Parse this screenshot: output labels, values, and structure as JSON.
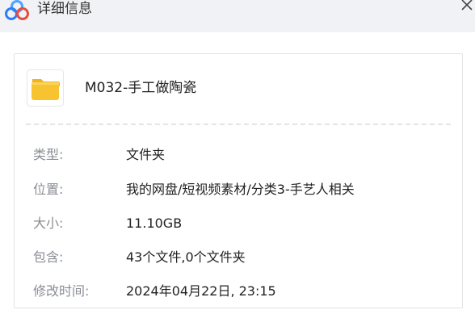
{
  "window": {
    "title": "详细信息",
    "logo_icon": "baidu-netdisk-logo",
    "close_icon": "close-icon"
  },
  "file": {
    "name": "M032-手工做陶瓷",
    "icon": "folder-icon",
    "icon_color": "#f7c331"
  },
  "details": [
    {
      "label": "类型:",
      "value": "文件夹"
    },
    {
      "label": "位置:",
      "value": "我的网盘/短视频素材/分类3-手艺人相关"
    },
    {
      "label": "大小:",
      "value": "11.10GB"
    },
    {
      "label": "包含:",
      "value": "43个文件,0个文件夹"
    },
    {
      "label": "修改时间:",
      "value": "2024年04月22日, 23:15"
    }
  ]
}
